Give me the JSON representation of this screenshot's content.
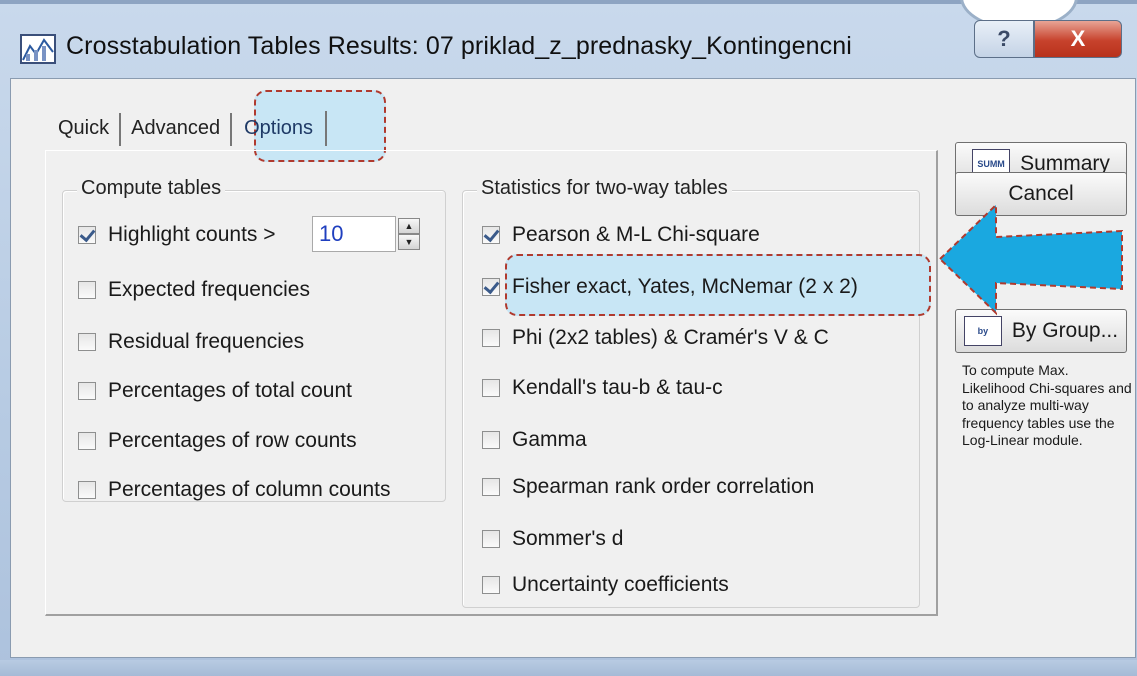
{
  "window": {
    "title": "Crosstabulation Tables Results: 07 priklad_z_prednasky_Kontingencni",
    "help_label": "?",
    "close_label": "X"
  },
  "tabs": [
    {
      "label": "Quick",
      "selected": false
    },
    {
      "label": "Advanced",
      "selected": false
    },
    {
      "label": "Options",
      "selected": true
    }
  ],
  "compute_tables": {
    "title": "Compute tables",
    "highlight": {
      "label": "Highlight counts >",
      "checked": true,
      "value": "10"
    },
    "items": [
      {
        "label": "Expected frequencies",
        "checked": false
      },
      {
        "label": "Residual frequencies",
        "checked": false
      },
      {
        "label": "Percentages of total count",
        "checked": false
      },
      {
        "label": "Percentages of row counts",
        "checked": false
      },
      {
        "label": "Percentages of column counts",
        "checked": false
      }
    ]
  },
  "statistics": {
    "title": "Statistics for two-way tables",
    "items": [
      {
        "label": "Pearson & M-L Chi-square",
        "checked": true
      },
      {
        "label": "Fisher exact, Yates, McNemar (2 x 2)",
        "checked": true
      },
      {
        "label": "Phi (2x2 tables) & Cramér's V &  C",
        "checked": false
      },
      {
        "label": "Kendall's tau-b & tau-c",
        "checked": false
      },
      {
        "label": "Gamma",
        "checked": false
      },
      {
        "label": "Spearman rank order correlation",
        "checked": false
      },
      {
        "label": "Sommer's d",
        "checked": false
      },
      {
        "label": "Uncertainty coefficients",
        "checked": false
      }
    ]
  },
  "side_buttons": {
    "summary": "Summary",
    "summary_icon": "SUMM",
    "cancel": "Cancel",
    "by_group": "By Group...",
    "by_group_icon": "by"
  },
  "note": "To compute Max. Likelihood Chi-squares and to analyze multi-way frequency tables use the Log-Linear module.",
  "colors": {
    "highlight_fill": "#c8e6f5",
    "highlight_border": "#b03a2e",
    "arrow": "#1aa8e0"
  }
}
